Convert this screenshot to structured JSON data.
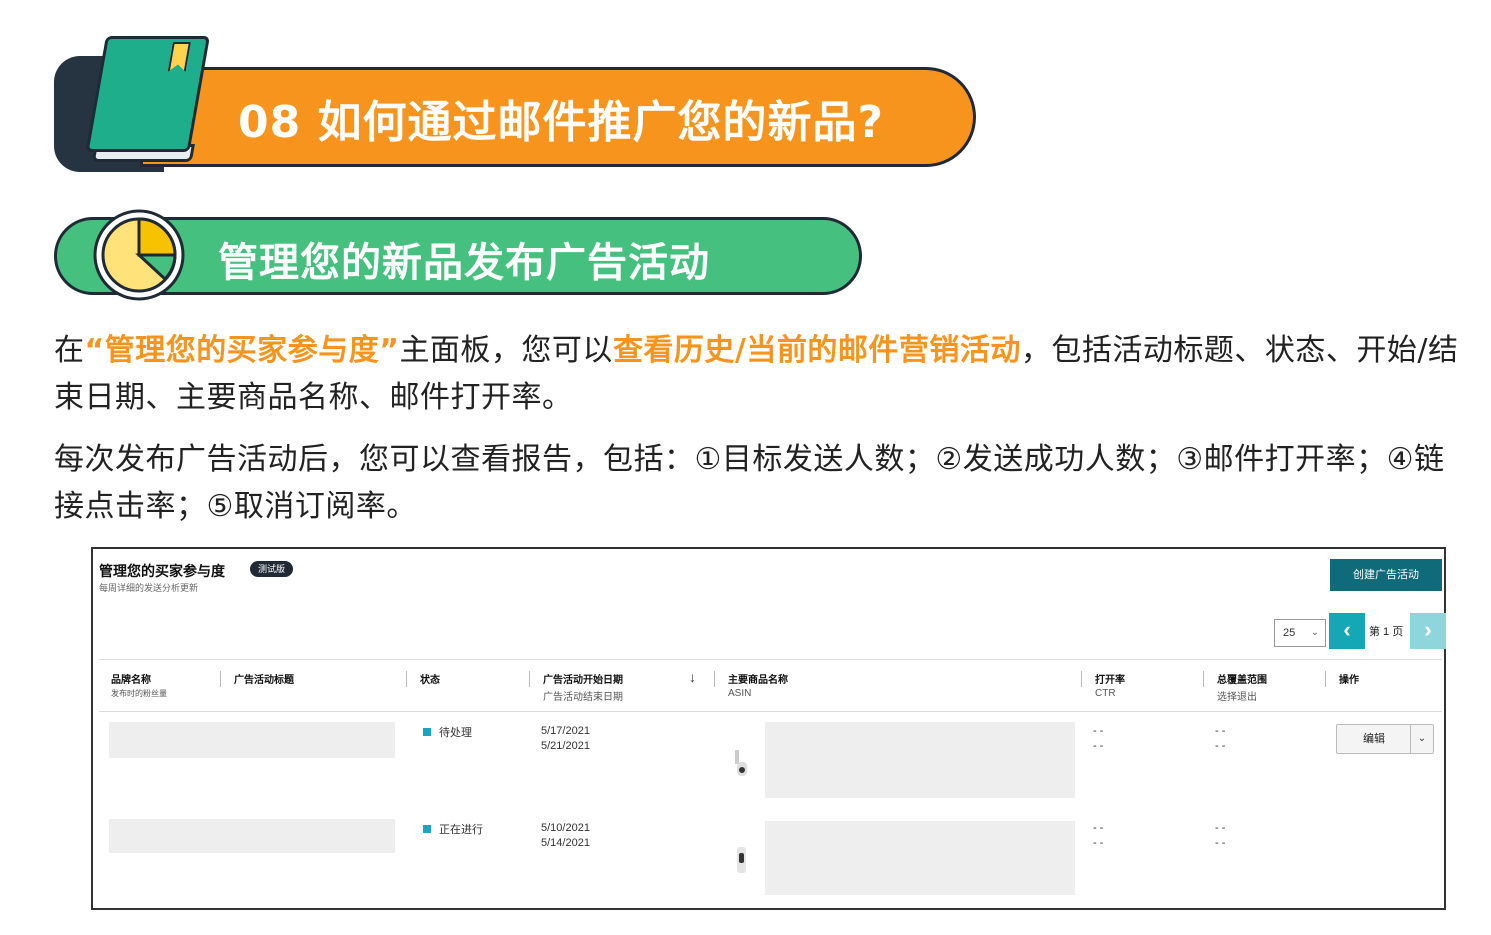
{
  "section_header": {
    "number": "08",
    "title": "08 如何通过邮件推广您的新品?"
  },
  "sub_header": {
    "title": "管理您的新品发布广告活动"
  },
  "paragraph1": {
    "part1": "在",
    "highlight1": "“管理您的买家参与度”",
    "part2": "主面板，您可以",
    "highlight2": "查看历史/当前的邮件营销活动",
    "part3": "，包括活动标题、状态、开始/结束日期、主要商品名称、邮件打开率。"
  },
  "paragraph2": "每次发布广告活动后，您可以查看报告，包括：①目标发送人数；②发送成功人数；③邮件打开率；④链接点击率；⑤取消订阅率。",
  "colors": {
    "orange": "#f7941d",
    "green": "#46c07e",
    "dark": "#1f2a36",
    "teal": "#0f6a7a",
    "status_blue": "#1aa3c7"
  },
  "screenshot": {
    "title": "管理您的买家参与度",
    "badge": "测试版",
    "subtitle": "每周详细的发送分析更新",
    "create_button": "创建广告活动",
    "page_size": "25",
    "page_label": "第 1 页",
    "columns": [
      {
        "title": "品牌名称",
        "sub": "发布时的粉丝量"
      },
      {
        "title": "广告活动标题",
        "sub": ""
      },
      {
        "title": "状态",
        "sub": ""
      },
      {
        "title": "广告活动开始日期",
        "sub": "广告活动结束日期"
      },
      {
        "title": "主要商品名称",
        "sub": "ASIN"
      },
      {
        "title": "打开率",
        "sub": "CTR"
      },
      {
        "title": "总覆盖范围",
        "sub": "选择退出"
      },
      {
        "title": "操作",
        "sub": ""
      }
    ],
    "rows": [
      {
        "status": "待处理",
        "start": "5/17/2021",
        "end": "5/21/2021",
        "open": "- -",
        "ctr": "- -",
        "reach": "- -",
        "optout": "- -",
        "action": "编辑"
      },
      {
        "status": "正在进行",
        "start": "5/10/2021",
        "end": "5/14/2021",
        "open": "- -",
        "ctr": "- -",
        "reach": "- -",
        "optout": "- -"
      }
    ]
  }
}
